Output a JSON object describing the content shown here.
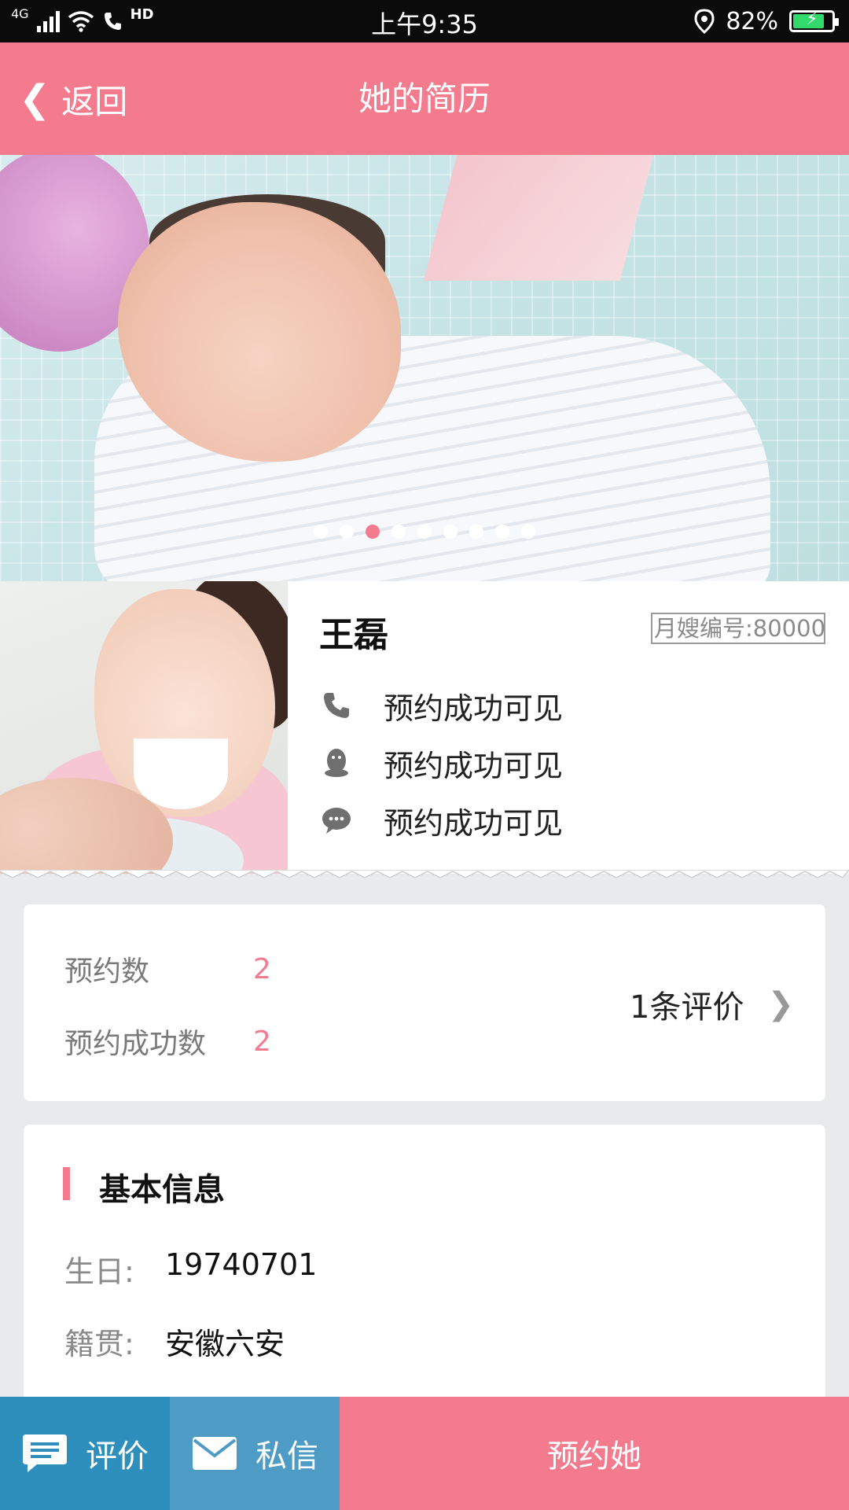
{
  "status_bar": {
    "network": "4G",
    "hd": "HD",
    "time": "上午9:35",
    "battery_percent": "82%",
    "battery_level": 0.82
  },
  "header": {
    "back_label": "返回",
    "title": "她的简历"
  },
  "banner": {
    "slide_count": 9,
    "active_index": 2
  },
  "profile": {
    "name": "王磊",
    "nanny_id": "月嫂编号:80000l",
    "contacts": [
      {
        "icon": "phone-icon",
        "text": "预约成功可见"
      },
      {
        "icon": "qq-icon",
        "text": "预约成功可见"
      },
      {
        "icon": "wechat-icon",
        "text": "预约成功可见"
      }
    ]
  },
  "stats": {
    "bookings_label": "预约数",
    "bookings_value": "2",
    "success_label": "预约成功数",
    "success_value": "2",
    "reviews_label": "1条评价"
  },
  "basic_info": {
    "title": "基本信息",
    "rows": [
      {
        "label": "生日:",
        "value": "19740701"
      },
      {
        "label": "籍贯:",
        "value": "安徽六安"
      }
    ]
  },
  "bottom_bar": {
    "review_label": "评价",
    "message_label": "私信",
    "book_label": "预约她"
  },
  "colors": {
    "accent": "#f47b8d",
    "review_button": "#2f8fbc",
    "message_button": "#4e9cc5"
  }
}
